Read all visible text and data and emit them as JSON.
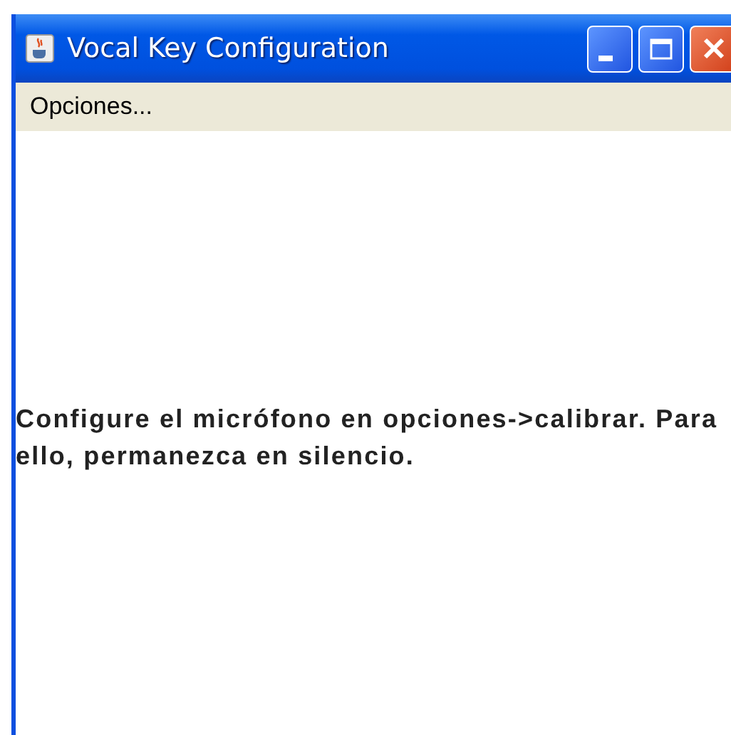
{
  "window": {
    "title": "Vocal Key Configuration"
  },
  "menu_bar": {
    "items": [
      {
        "label": "Opciones..."
      }
    ]
  },
  "message": "Configure el micrófono en opciones->calibrar. Para ello, permanezca en silencio."
}
